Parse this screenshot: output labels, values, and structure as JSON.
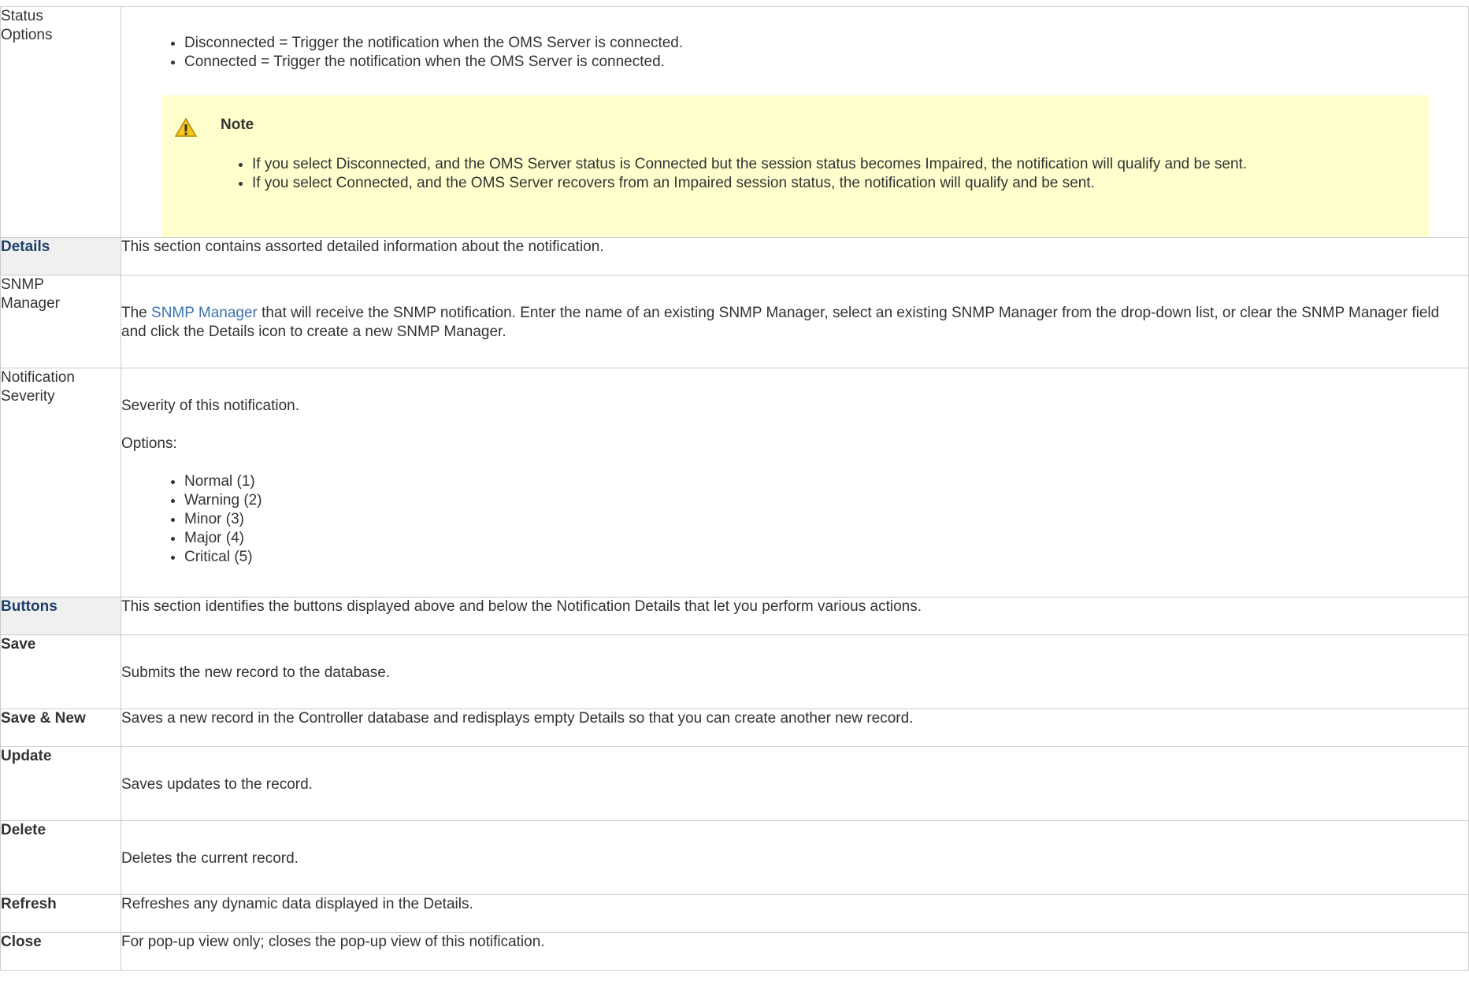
{
  "rows": {
    "status_options": {
      "label_line1": "Status",
      "label_line2": "Options",
      "bullets": [
        "Disconnected = Trigger the notification when the OMS Server is connected.",
        "Connected = Trigger the notification when the OMS Server is connected."
      ],
      "note": {
        "title": "Note",
        "icon": "warning-icon",
        "bullets": [
          "If you select Disconnected, and the OMS Server status is Connected but the session status becomes Impaired, the notification will qualify and be sent.",
          "If you select Connected, and the OMS Server recovers from an Impaired session status, the notification will qualify and be sent."
        ]
      }
    },
    "details_header": {
      "label": "Details",
      "text": "This section contains assorted detailed information about the notification."
    },
    "snmp_manager": {
      "label_line1": "SNMP",
      "label_line2": "Manager",
      "text_before": "The ",
      "link": "SNMP Manager",
      "text_after": " that will receive the SNMP notification. Enter the name of an existing SNMP Manager, select an existing SNMP Manager from the drop-down list, or clear the SNMP Manager field and click the Details icon to create a new SNMP Manager."
    },
    "notification_severity": {
      "label_line1": "Notification",
      "label_line2": "Severity",
      "text": "Severity of this notification.",
      "options_label": "Options:",
      "options": [
        "Normal (1)",
        "Warning (2)",
        "Minor (3)",
        "Major (4)",
        "Critical (5)"
      ]
    },
    "buttons_header": {
      "label": "Buttons",
      "text": "This section identifies the buttons displayed above and below the Notification Details that let you perform various actions."
    },
    "save": {
      "label": "Save",
      "text": "Submits the new record to the database."
    },
    "save_new": {
      "label": "Save & New",
      "text": "Saves a new record in the Controller database and redisplays empty Details so that you can create another new record."
    },
    "update": {
      "label": "Update",
      "text": "Saves updates to the record."
    },
    "delete": {
      "label": "Delete",
      "text": "Deletes the current record."
    },
    "refresh": {
      "label": "Refresh",
      "text": "Refreshes any dynamic data displayed in the Details."
    },
    "close": {
      "label": "Close",
      "text": "For pop-up view only; closes the pop-up view of this notification."
    }
  }
}
